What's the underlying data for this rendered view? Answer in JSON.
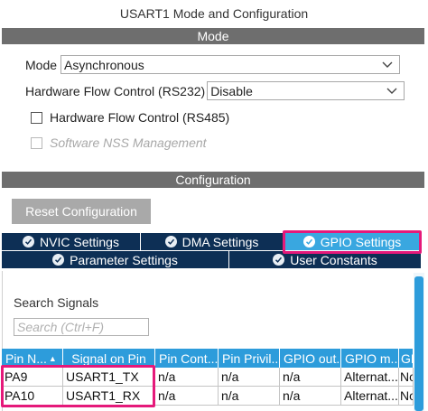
{
  "window": {
    "title": "USART1 Mode and Configuration"
  },
  "mode_section": {
    "header": "Mode",
    "mode_label": "Mode",
    "mode_value": "Asynchronous",
    "rs232_label": "Hardware Flow Control (RS232)",
    "rs232_value": "Disable",
    "rs485_label": "Hardware Flow Control (RS485)",
    "nss_label": "Software NSS Management"
  },
  "config_section": {
    "header": "Configuration",
    "reset_label": "Reset Configuration",
    "tabs": [
      {
        "label": "NVIC Settings",
        "active": false
      },
      {
        "label": "DMA Settings",
        "active": false
      },
      {
        "label": "GPIO Settings",
        "active": true
      },
      {
        "label": "Parameter Settings",
        "active": false
      },
      {
        "label": "User Constants",
        "active": false
      }
    ]
  },
  "signals": {
    "search_label": "Search Signals",
    "search_placeholder": "Search (Ctrl+F)",
    "columns": [
      "Pin N...",
      "Signal on Pin",
      "Pin Cont...",
      "Pin Privil...",
      "GPIO out...",
      "GPIO m...",
      "GP"
    ],
    "rows": [
      [
        "PA9",
        "USART1_TX",
        "n/a",
        "n/a",
        "n/a",
        "Alternat...",
        "No"
      ],
      [
        "PA10",
        "USART1_RX",
        "n/a",
        "n/a",
        "n/a",
        "Alternat...",
        "No"
      ]
    ]
  },
  "colors": {
    "section_header": "#6e6e6e",
    "tab_dark": "#0d2f55",
    "tab_active": "#39a7e0",
    "table_header": "#2d9cdb",
    "highlight": "#e5197a",
    "reset_button": "#a9a9a9"
  },
  "icons": {
    "select_arrow": "chevron-down-icon",
    "tab_status": "check-circle-icon",
    "sort": "sort-up-icon"
  }
}
